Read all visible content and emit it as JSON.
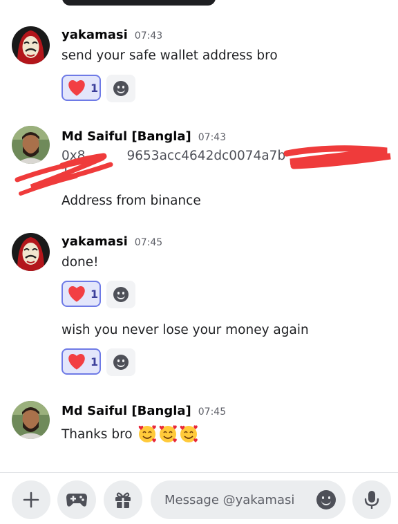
{
  "messages": [
    {
      "author": "yakamasi",
      "time": "07:43",
      "avatar": "dali-mask-avatar",
      "lines": [
        "send your safe wallet address bro"
      ],
      "reactions": [
        {
          "emoji": "heart",
          "count": "1"
        }
      ]
    },
    {
      "author": "Md Saiful [Bangla]",
      "time": "07:43",
      "avatar": "bearded-man-avatar",
      "address_fragment": "9653acc4642dc0074a7b",
      "address_prefix": "0x8",
      "address_suffix": "",
      "address_line2": "1",
      "lines": [
        "Address from binance"
      ]
    },
    {
      "author": "yakamasi",
      "time": "07:45",
      "avatar": "dali-mask-avatar",
      "lines": [
        "done!",
        "wish you never lose your money again"
      ],
      "reactions": [
        {
          "emoji": "heart",
          "count": "1"
        },
        {
          "emoji": "heart",
          "count": "1"
        }
      ]
    },
    {
      "author": "Md Saiful [Bangla]",
      "time": "07:45",
      "avatar": "bearded-man-avatar",
      "lines": [
        "Thanks bro"
      ],
      "emojis": [
        "smiling-face-with-hearts",
        "smiling-face-with-hearts",
        "smiling-face-with-hearts"
      ]
    }
  ],
  "composer": {
    "placeholder": "Message @yakamasi",
    "buttons": [
      "plus-icon",
      "gamepad-icon",
      "gift-icon",
      "emoji-icon",
      "microphone-icon"
    ]
  },
  "colors": {
    "reaction_border": "#6e7ae6",
    "reaction_bg": "#e3e6fb",
    "heart": "#f23f43",
    "redaction_scribble": "#ef3b3b"
  }
}
